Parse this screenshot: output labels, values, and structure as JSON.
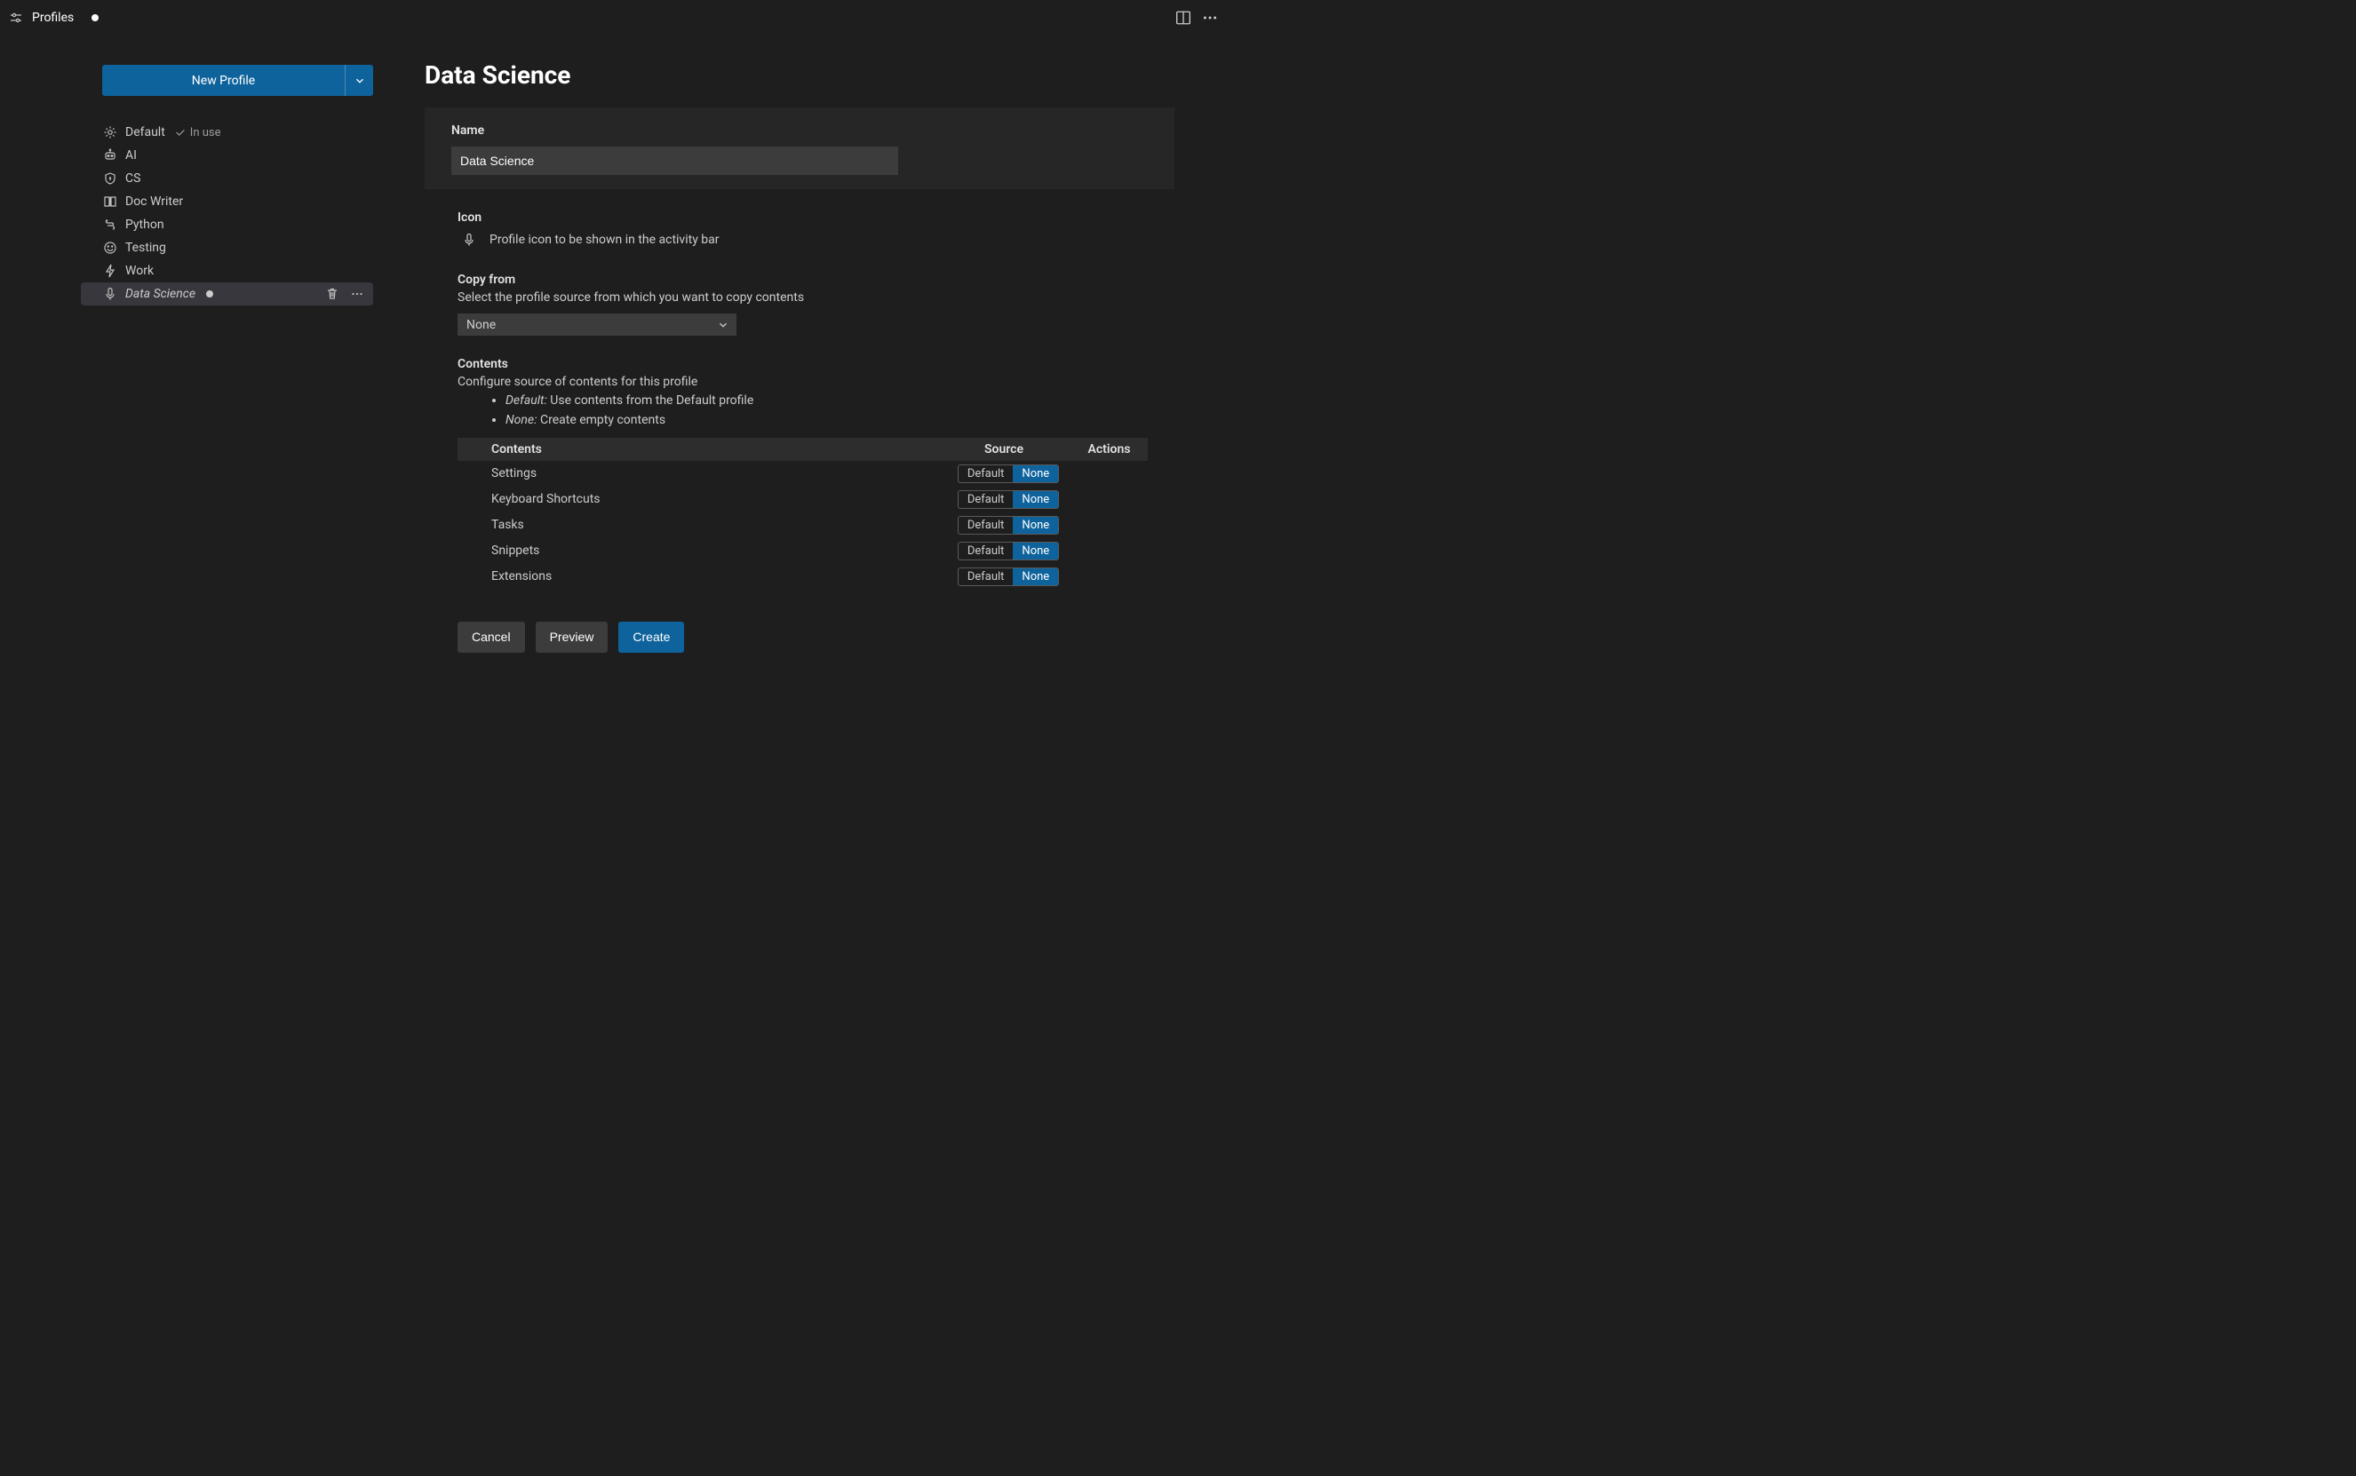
{
  "tab": {
    "title": "Profiles",
    "dirty": true
  },
  "sidebar": {
    "new_profile_label": "New Profile",
    "items": [
      {
        "label": "Default",
        "icon": "gear",
        "in_use": "In use"
      },
      {
        "label": "AI",
        "icon": "robot"
      },
      {
        "label": "CS",
        "icon": "shield"
      },
      {
        "label": "Doc Writer",
        "icon": "book"
      },
      {
        "label": "Python",
        "icon": "snake"
      },
      {
        "label": "Testing",
        "icon": "smile"
      },
      {
        "label": "Work",
        "icon": "bolt"
      },
      {
        "label": "Data Science",
        "icon": "mic",
        "selected": true,
        "dirty": true
      }
    ]
  },
  "main": {
    "title": "Data Science",
    "name_label": "Name",
    "name_value": "Data Science",
    "icon_label": "Icon",
    "icon_hint": "Profile icon to be shown in the activity bar",
    "copy_from_label": "Copy from",
    "copy_from_desc": "Select the profile source from which you want to copy contents",
    "copy_from_value": "None",
    "contents_label": "Contents",
    "contents_desc": "Configure source of contents for this profile",
    "bullets": [
      {
        "term": "Default:",
        "text": " Use contents from the Default profile"
      },
      {
        "term": "None:",
        "text": " Create empty contents"
      }
    ],
    "table": {
      "headers": [
        "Contents",
        "Source",
        "Actions"
      ],
      "options": {
        "default": "Default",
        "none": "None"
      },
      "rows": [
        {
          "label": "Settings",
          "source": "None"
        },
        {
          "label": "Keyboard Shortcuts",
          "source": "None"
        },
        {
          "label": "Tasks",
          "source": "None"
        },
        {
          "label": "Snippets",
          "source": "None"
        },
        {
          "label": "Extensions",
          "source": "None"
        }
      ]
    },
    "buttons": {
      "cancel": "Cancel",
      "preview": "Preview",
      "create": "Create"
    }
  }
}
